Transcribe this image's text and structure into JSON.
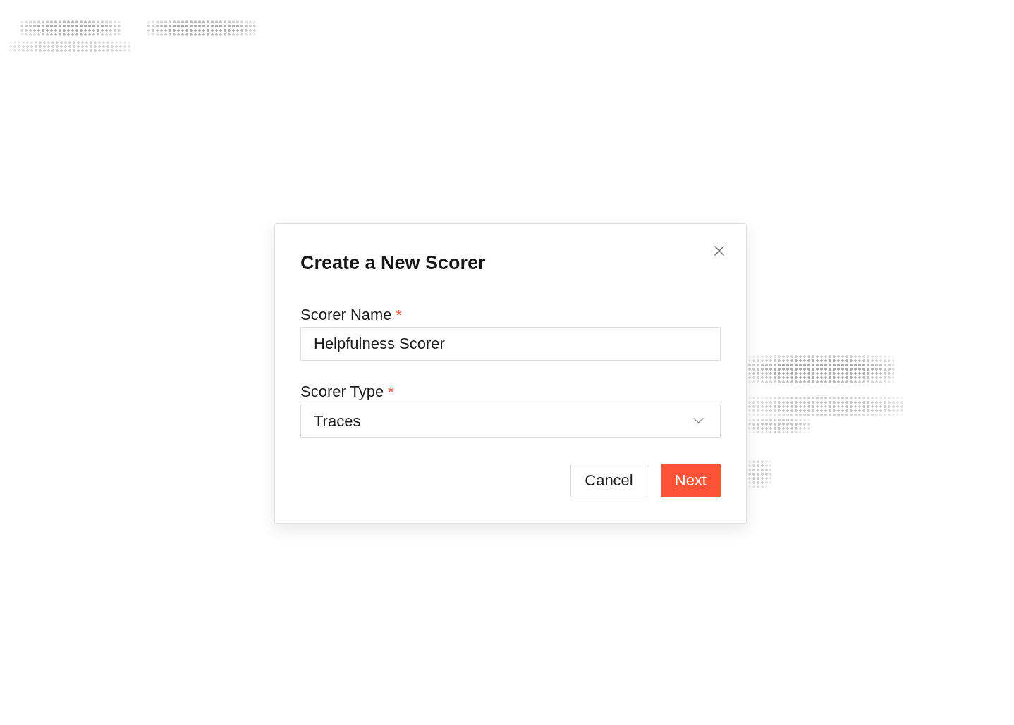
{
  "dialog": {
    "title": "Create a New Scorer",
    "fields": [
      {
        "kind": "text",
        "label": "Scorer Name",
        "required_mark": "*",
        "value": "Helpfulness Scorer"
      },
      {
        "kind": "select",
        "label": "Scorer Type",
        "required_mark": "*",
        "value": "Traces"
      }
    ],
    "buttons": [
      {
        "kind": "secondary",
        "label": "Cancel"
      },
      {
        "kind": "primary",
        "label": "Next"
      }
    ]
  }
}
